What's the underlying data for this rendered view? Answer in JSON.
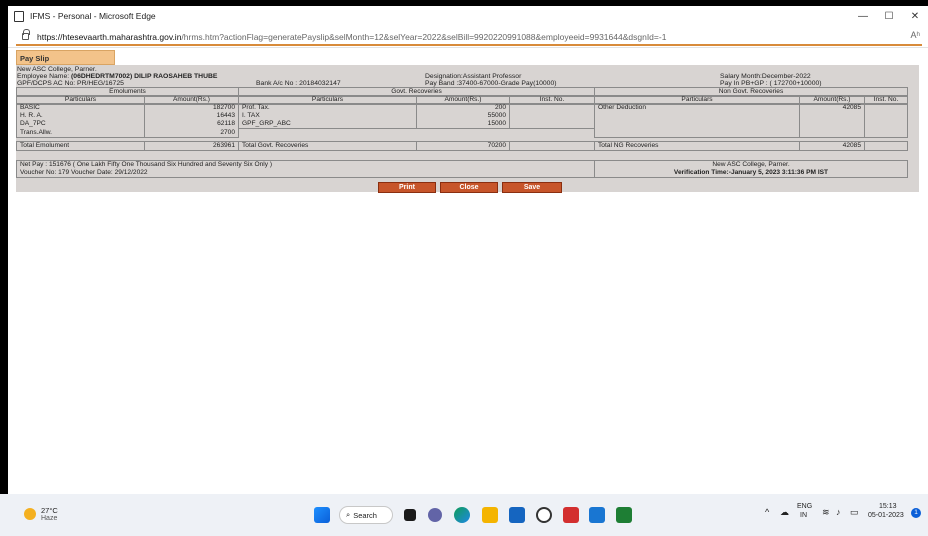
{
  "window": {
    "title": "IFMS - Personal - Microsoft Edge",
    "minimize": "—",
    "maximize": "☐",
    "close": "✕"
  },
  "address": {
    "url_host": "https://htesevaarth.maharashtra.gov.in",
    "url_path": "/hrms.htm?actionFlag=generatePayslip&selMonth=12&selYear=2022&selBill=9920220991088&employeeid=9931644&dsgnId=-1",
    "read_aloud": "Aʰ"
  },
  "payslip": {
    "tab_label": "Pay Slip",
    "college": "New ASC College, Parner.",
    "employee_name_label": "Employee Name:",
    "employee_name": "(06DHEDRTM7002) DILIP RAOSAHEB THUBE",
    "gpf": "GPF/DCPS AC No: PR/HEG/16725",
    "bank": "Bank A/c No : 20184032147",
    "designation": "Designation:Assistant Professor",
    "pay_band": "Pay Band :37400-67000-Grade Pay(10000)",
    "salary_month": "Salary Month:December-2022",
    "pay_in": "Pay In PB+GP : ( 172700+10000)",
    "sections": {
      "emoluments": "Emoluments",
      "govt_recoveries": "Govt. Recoveries",
      "non_govt_recoveries": "Non Govt. Recoveries"
    },
    "columns": {
      "particulars": "Particulars",
      "amount": "Amount(Rs.)",
      "inst_no": "Inst. No."
    },
    "emoluments": [
      {
        "name": "BASIC",
        "amount": "182700"
      },
      {
        "name": "H. R. A.",
        "amount": "16443"
      },
      {
        "name": "DA_7PC",
        "amount": "62118"
      },
      {
        "name": "Trans.Allw.",
        "amount": "2700"
      }
    ],
    "govt_recoveries": [
      {
        "name": "Prof. Tax.",
        "amount": "200"
      },
      {
        "name": "I. TAX",
        "amount": "55000"
      },
      {
        "name": "GPF_GRP_ABC",
        "amount": "15000"
      }
    ],
    "non_govt_recoveries": [
      {
        "name": "Other Deduction",
        "amount": "42085"
      }
    ],
    "totals": {
      "emolument_label": "Total Emolument",
      "emolument_value": "263961",
      "govt_label": "Total Govt. Recoveries",
      "govt_value": "70200",
      "ng_label": "Total NG Recoveries",
      "ng_value": "42085"
    },
    "net_pay": "Net Pay :     151676 ( One Lakh Fifty One Thousand Six Hundred and Seventy Six Only )",
    "voucher": "Voucher No: 179     Voucher Date: 29/12/2022",
    "footer_college": "New ASC College, Parner.",
    "verification": "Verification Time:-January 5, 2023 3:11:36 PM IST",
    "buttons": {
      "print": "Print",
      "close": "Close",
      "save": "Save"
    }
  },
  "taskbar": {
    "temp": "27°C",
    "condition": "Haze",
    "search": "Search",
    "lang_top": "ENG",
    "lang_bottom": "IN",
    "time": "15:13",
    "date": "05-01-2023",
    "notifications": "1"
  }
}
